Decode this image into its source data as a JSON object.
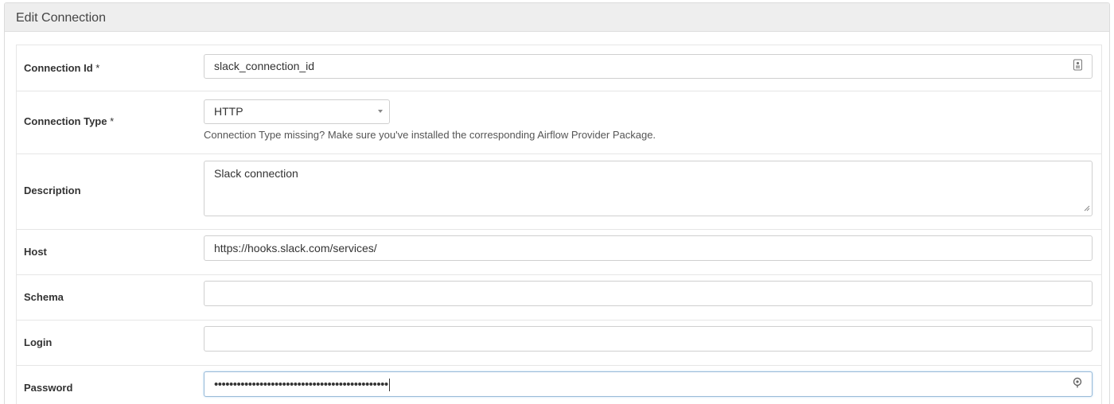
{
  "panel": {
    "title": "Edit Connection"
  },
  "fields": {
    "connection_id": {
      "label": "Connection Id",
      "required_mark": "*",
      "value": "slack_connection_id",
      "icon": "id-card-icon"
    },
    "connection_type": {
      "label": "Connection Type",
      "required_mark": "*",
      "value": "HTTP",
      "help": "Connection Type missing? Make sure you've installed the corresponding Airflow Provider Package."
    },
    "description": {
      "label": "Description",
      "value": "Slack connection"
    },
    "host": {
      "label": "Host",
      "value": "https://hooks.slack.com/services/"
    },
    "schema": {
      "label": "Schema",
      "value": ""
    },
    "login": {
      "label": "Login",
      "value": ""
    },
    "password": {
      "label": "Password",
      "value": "••••••••••••••••••••••••••••••••••••••••••••••",
      "icon": "key-icon"
    }
  },
  "colors": {
    "heading_bg": "#eeeeee",
    "border": "#cfcfcf",
    "focus_border": "#9bbbd8"
  }
}
